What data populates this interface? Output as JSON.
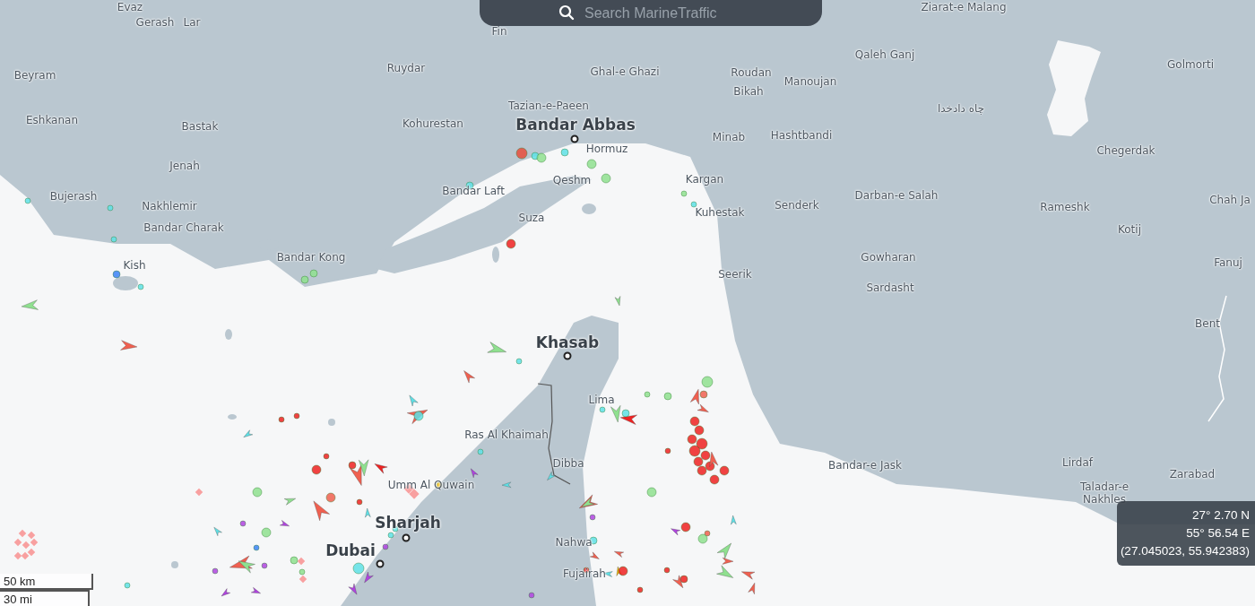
{
  "search": {
    "placeholder": "Search MarineTraffic"
  },
  "places": [
    {
      "name": "Evaz",
      "kind": "town"
    },
    {
      "name": "Gerash",
      "kind": "town"
    },
    {
      "name": "Lar",
      "kind": "town"
    },
    {
      "name": "Fin",
      "kind": "town"
    },
    {
      "name": "Ziarat-e Malang",
      "kind": "town"
    },
    {
      "name": "Beyram",
      "kind": "town"
    },
    {
      "name": "Ruydar",
      "kind": "town"
    },
    {
      "name": "Ghal-e Ghazi",
      "kind": "town"
    },
    {
      "name": "Roudan",
      "kind": "town"
    },
    {
      "name": "Manoujan",
      "kind": "town"
    },
    {
      "name": "Qaleh Ganj",
      "kind": "town"
    },
    {
      "name": "Golmorti",
      "kind": "town"
    },
    {
      "name": "Bikah",
      "kind": "town"
    },
    {
      "name": "Tazian-e-Paeen",
      "kind": "town"
    },
    {
      "name": "چاه دادخدا",
      "kind": "town"
    },
    {
      "name": "Eshkanan",
      "kind": "town"
    },
    {
      "name": "Bastak",
      "kind": "town"
    },
    {
      "name": "Kohurestan",
      "kind": "town"
    },
    {
      "name": "Bandar Abbas",
      "kind": "port"
    },
    {
      "name": "Hormuz",
      "kind": "town"
    },
    {
      "name": "Minab",
      "kind": "town"
    },
    {
      "name": "Hashtbandi",
      "kind": "town"
    },
    {
      "name": "Chegerdak",
      "kind": "town"
    },
    {
      "name": "Jenah",
      "kind": "town"
    },
    {
      "name": "Qeshm",
      "kind": "town"
    },
    {
      "name": "Kargan",
      "kind": "town"
    },
    {
      "name": "Bandar Laft",
      "kind": "town"
    },
    {
      "name": "Bujerash",
      "kind": "town"
    },
    {
      "name": "Nakhlemir",
      "kind": "town"
    },
    {
      "name": "Senderk",
      "kind": "town"
    },
    {
      "name": "Darban-e Salah",
      "kind": "town"
    },
    {
      "name": "Rameshk",
      "kind": "town"
    },
    {
      "name": "Chah Ja",
      "kind": "town"
    },
    {
      "name": "Suza",
      "kind": "town"
    },
    {
      "name": "Kuhestak",
      "kind": "town"
    },
    {
      "name": "Kotij",
      "kind": "town"
    },
    {
      "name": "Bandar Charak",
      "kind": "town"
    },
    {
      "name": "Gowharan",
      "kind": "town"
    },
    {
      "name": "Bandar Kong",
      "kind": "town"
    },
    {
      "name": "Fanuj",
      "kind": "town"
    },
    {
      "name": "Kish",
      "kind": "town"
    },
    {
      "name": "Seerik",
      "kind": "town"
    },
    {
      "name": "Sardasht",
      "kind": "town"
    },
    {
      "name": "Bent",
      "kind": "town"
    },
    {
      "name": "Khasab",
      "kind": "port"
    },
    {
      "name": "Lima",
      "kind": "town"
    },
    {
      "name": "Ras Al Khaimah",
      "kind": "town"
    },
    {
      "name": "Bandar-e Jask",
      "kind": "town"
    },
    {
      "name": "Lirdaf",
      "kind": "town"
    },
    {
      "name": "Zarabad",
      "kind": "town"
    },
    {
      "name": "Dibba",
      "kind": "town"
    },
    {
      "name": "Umm Al Quwain",
      "kind": "town"
    },
    {
      "name": "Taladar-e Nakhles",
      "kind": "town"
    },
    {
      "name": "Sharjah",
      "kind": "port"
    },
    {
      "name": "Nahwa",
      "kind": "town"
    },
    {
      "name": "Dubai",
      "kind": "port"
    },
    {
      "name": "Fujairah",
      "kind": "town"
    }
  ],
  "scale": [
    "50 km",
    "30 mi"
  ],
  "coordinates": [
    "27° 2.70 N",
    "55° 56.54 E",
    "(27.045023, 55.942383)"
  ]
}
